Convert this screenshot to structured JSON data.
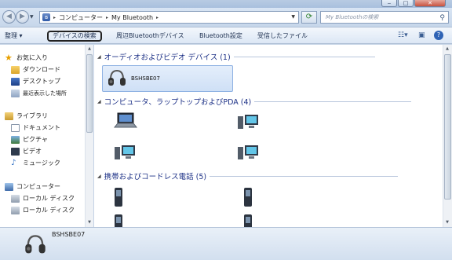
{
  "window": {
    "accent": "#1e3287",
    "frame_color": "#c7d6e8"
  },
  "address": {
    "crumbs": [
      "コンピューター",
      "My Bluetooth"
    ],
    "search_placeholder": "My Bluetoothの検索"
  },
  "toolbar": {
    "organize": "整理 ▾",
    "search_devices": "デバイスの検索",
    "nearby_devices": "周辺Bluetoothデバイス",
    "bluetooth_settings": "Bluetooth設定",
    "received_files": "受信したファイル"
  },
  "nav": {
    "favorites": "お気に入り",
    "downloads": "ダウンロード",
    "desktop": "デスクトップ",
    "recent": "最近表示した場所",
    "libraries": "ライブラリ",
    "documents": "ドキュメント",
    "pictures": "ピクチャ",
    "videos": "ビデオ",
    "music": "ミュージック",
    "computer": "コンピューター",
    "local_disk_1": "ローカル ディスク",
    "local_disk_2": "ローカル ディスク"
  },
  "groups": {
    "audio": {
      "label": "オーディオおよびビデオ デバイス (1)",
      "device": "BSHSBE07"
    },
    "computers": {
      "label": "コンピュータ、ラップトップおよびPDA (4)"
    },
    "phones": {
      "label": "携帯およびコードレス電話 (5)"
    }
  },
  "details": {
    "selected_device": "BSHSBE07"
  }
}
